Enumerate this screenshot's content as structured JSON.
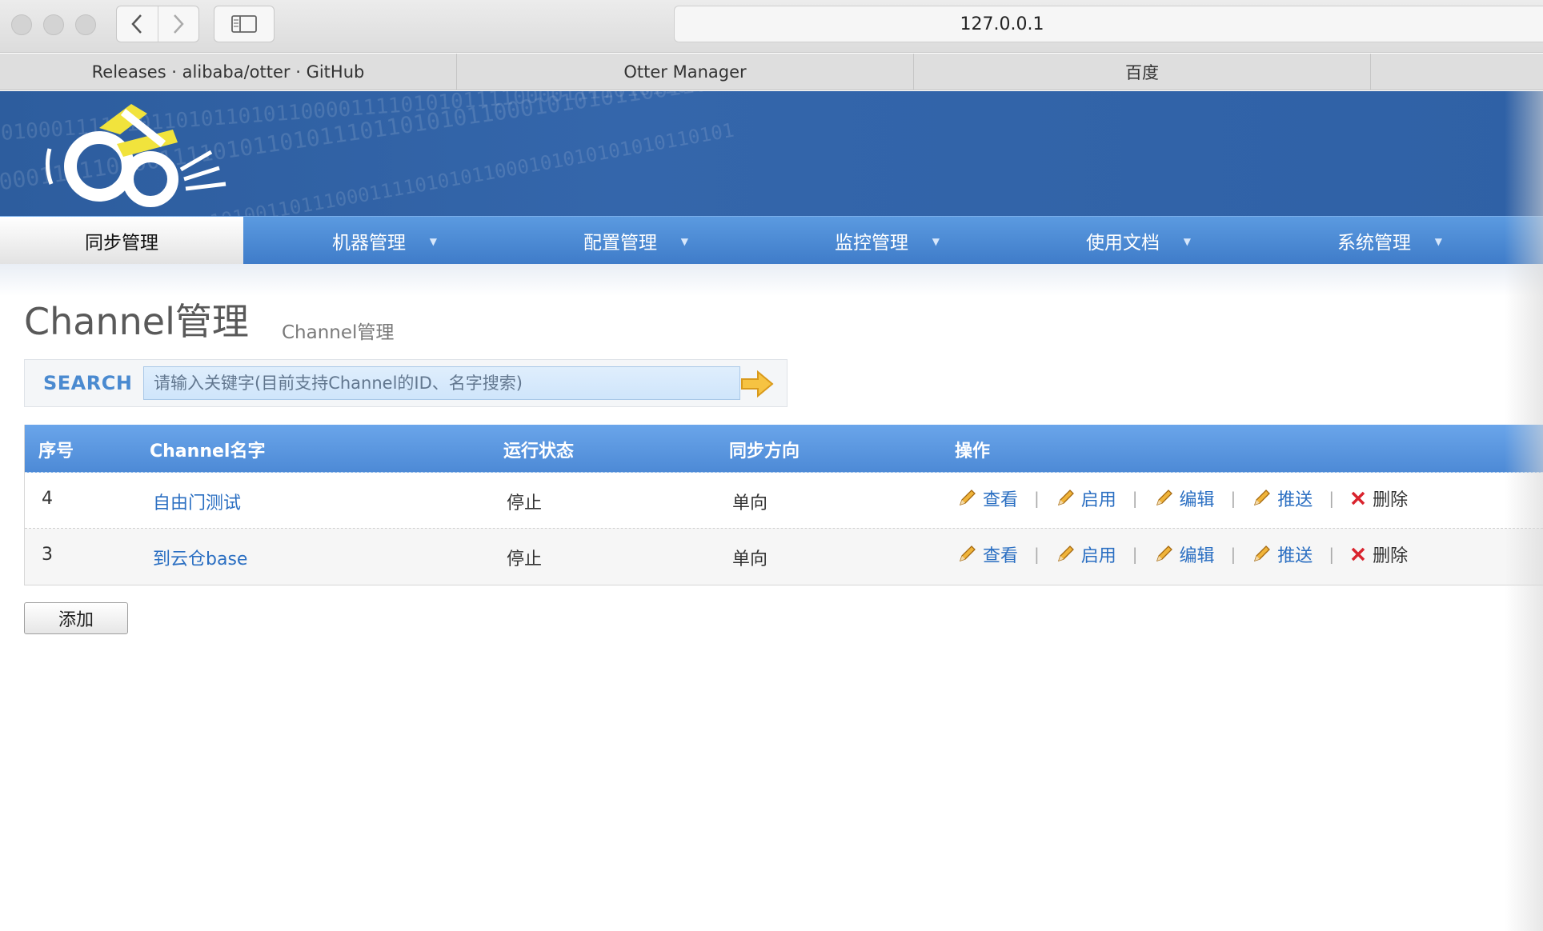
{
  "browser": {
    "url": "127.0.0.1",
    "tabs": [
      {
        "label": "Releases · alibaba/otter · GitHub"
      },
      {
        "label": "Otter Manager"
      },
      {
        "label": "百度"
      },
      {
        "label": ""
      }
    ]
  },
  "menu": {
    "items": [
      {
        "label": "同步管理",
        "active": true
      },
      {
        "label": "机器管理"
      },
      {
        "label": "配置管理"
      },
      {
        "label": "监控管理"
      },
      {
        "label": "使用文档"
      },
      {
        "label": "系统管理"
      }
    ]
  },
  "page": {
    "title": "Channel管理",
    "subtitle": "Channel管理"
  },
  "search": {
    "label": "SEARCH",
    "placeholder": "请输入关键字(目前支持Channel的ID、名字搜索)"
  },
  "table": {
    "columns": [
      "序号",
      "Channel名字",
      "运行状态",
      "同步方向",
      "操作"
    ],
    "rows": [
      {
        "id": "4",
        "name": "自由门测试",
        "status": "停止",
        "direction": "单向"
      },
      {
        "id": "3",
        "name": "到云仓base",
        "status": "停止",
        "direction": "单向"
      }
    ],
    "actions": [
      "查看",
      "启用",
      "编辑",
      "推送",
      "删除"
    ]
  },
  "add_button": "添加",
  "colors": {
    "banner": "#3466ab",
    "menu": "#4f8cd7",
    "link": "#2b6fc2",
    "delete_icon": "#d9232d"
  }
}
